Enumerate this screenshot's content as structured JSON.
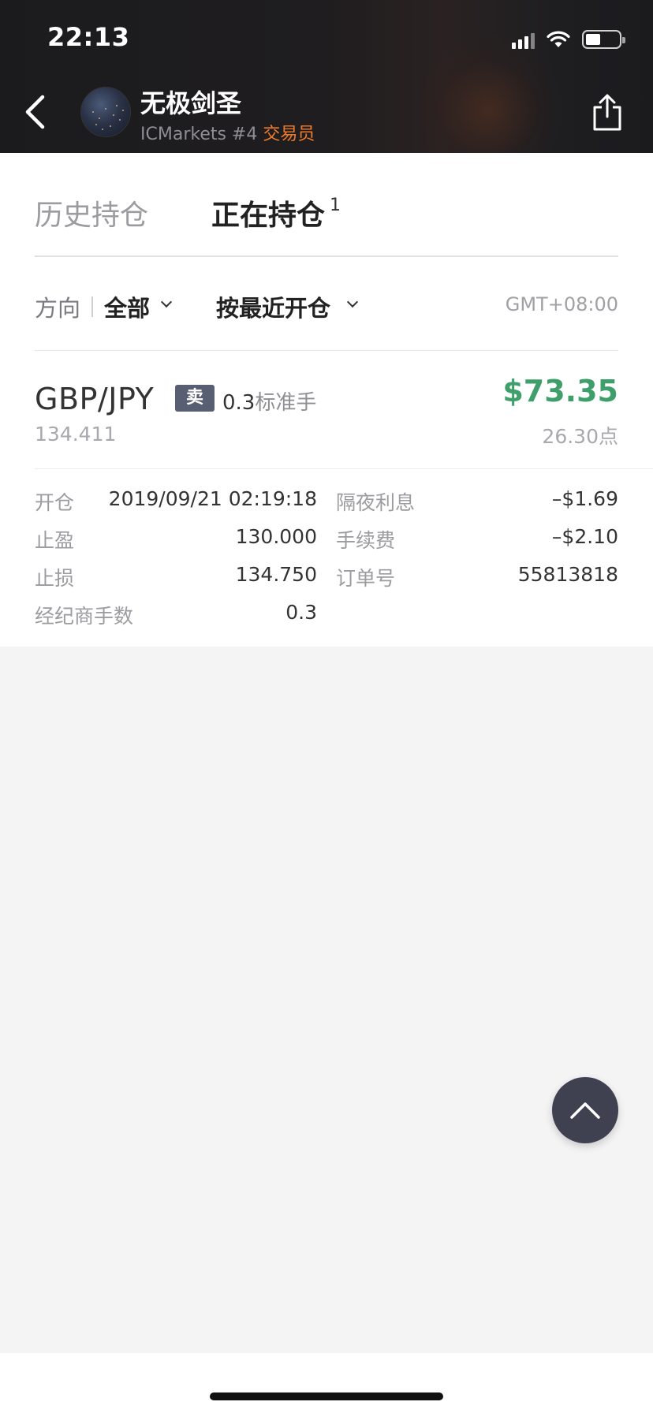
{
  "status_bar": {
    "time": "22:13"
  },
  "header": {
    "trader_name": "无极剑圣",
    "broker_info": "ICMarkets #4",
    "role": "交易员",
    "back_icon": "chevron-left-icon",
    "share_icon": "share-icon"
  },
  "tabs": [
    {
      "label": "历史持仓",
      "active": false
    },
    {
      "label": "正在持仓",
      "active": true,
      "count": "1"
    }
  ],
  "filters": {
    "direction_label": "方向",
    "direction_value": "全部",
    "sort_value": "按最近开仓",
    "timezone": "GMT+08:00"
  },
  "position": {
    "pair": "GBP/JPY",
    "side": "卖",
    "lots": "0.3",
    "lots_unit": "标准手",
    "profit": "$73.35",
    "current_price": "134.411",
    "points": "26.30点",
    "profit_color": "#3e9f6b",
    "side_badge_color": "#585f72",
    "details": {
      "open_label": "开仓",
      "open_value": "2019/09/21 02:19:18",
      "swap_label": "隔夜利息",
      "swap_value": "–$1.69",
      "tp_label": "止盈",
      "tp_value": "130.000",
      "fee_label": "手续费",
      "fee_value": "–$2.10",
      "sl_label": "止损",
      "sl_value": "134.750",
      "order_label": "订单号",
      "order_value": "55813818",
      "broker_lots_label": "经纪商手数",
      "broker_lots_value": "0.3"
    }
  },
  "scroll_top_icon": "chevron-up-icon",
  "role_color": "#f07b2a"
}
